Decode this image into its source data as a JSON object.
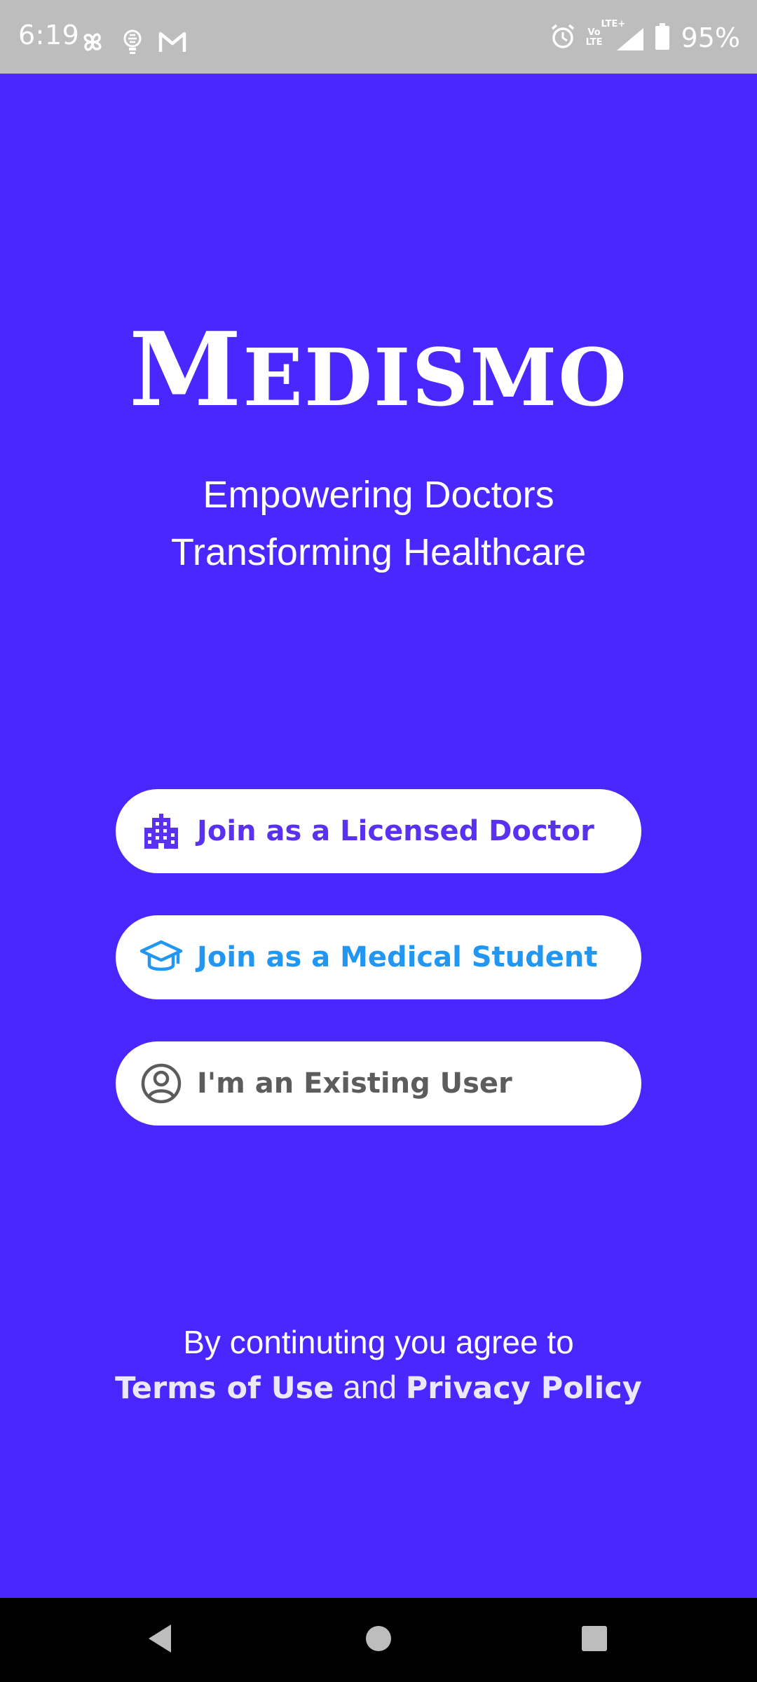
{
  "status_bar": {
    "time": "6:19",
    "battery_percent": "95%",
    "network_label": "LTE+",
    "volte_label_top": "Vo",
    "volte_label_bottom": "LTE",
    "battery_level": 0.95,
    "icons": [
      "pinwheel-icon",
      "bulb-icon",
      "gmail-icon",
      "alarm-icon",
      "volte-icon",
      "signal-icon",
      "battery-icon"
    ]
  },
  "app": {
    "logo_initial": "M",
    "logo_rest": "EDISMO",
    "tagline_line1": "Empowering Doctors",
    "tagline_line2": "Transforming Healthcare"
  },
  "buttons": {
    "doctor": {
      "label": "Join as a Licensed Doctor",
      "icon": "building-icon",
      "color": "#5a31f0"
    },
    "student": {
      "label": "Join as a Medical Student",
      "icon": "graduation-cap-icon",
      "color": "#2196f3"
    },
    "existing": {
      "label": "I'm an Existing User",
      "icon": "user-circle-icon",
      "color": "#5c5c5c"
    }
  },
  "legal": {
    "line1": "By continuting you agree to",
    "terms_label": "Terms of Use",
    "and_label": "and",
    "privacy_label": "Privacy Policy"
  },
  "colors": {
    "background": "#4a27fe",
    "status_bar": "#bdbdbd",
    "nav_bar": "#000000"
  },
  "nav": {
    "icons": [
      "back-icon",
      "home-icon",
      "recents-icon"
    ]
  }
}
